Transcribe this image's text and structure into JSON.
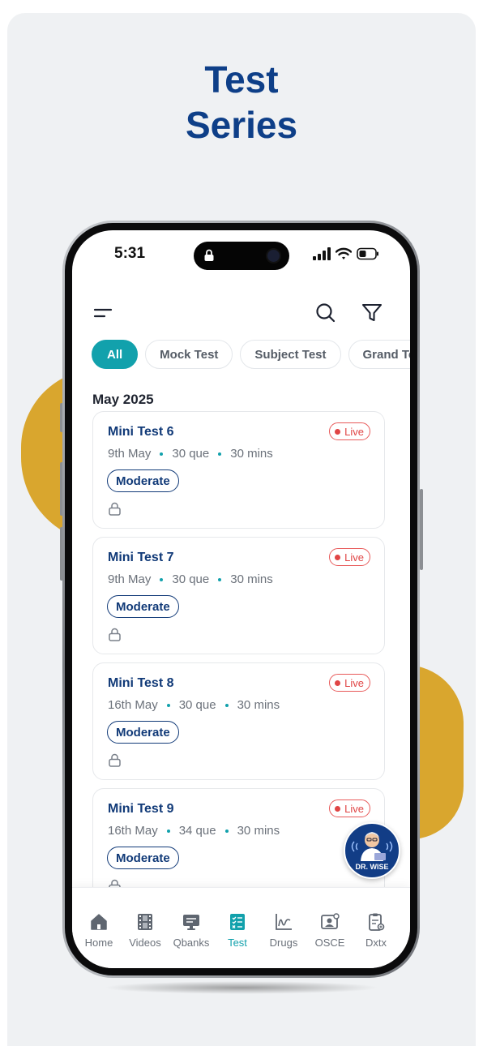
{
  "headline": {
    "line1": "Test",
    "line2": "Series"
  },
  "status_bar": {
    "time": "5:31"
  },
  "toolbar": {
    "menu_icon": "menu-icon",
    "search_icon": "search-icon",
    "filter_icon": "filter-icon"
  },
  "filters": {
    "chips": [
      {
        "label": "All",
        "active": true
      },
      {
        "label": "Mock Test",
        "active": false
      },
      {
        "label": "Subject Test",
        "active": false
      },
      {
        "label": "Grand Test",
        "active": false
      }
    ]
  },
  "section": {
    "title": "May 2025"
  },
  "tests": [
    {
      "title": "Mini Test 6",
      "status": "Live",
      "date": "9th May",
      "questions": "30 que",
      "duration": "30 mins",
      "level": "Moderate"
    },
    {
      "title": "Mini Test 7",
      "status": "Live",
      "date": "9th May",
      "questions": "30 que",
      "duration": "30 mins",
      "level": "Moderate"
    },
    {
      "title": "Mini Test 8",
      "status": "Live",
      "date": "16th May",
      "questions": "30 que",
      "duration": "30 mins",
      "level": "Moderate"
    },
    {
      "title": "Mini Test 9",
      "status": "Live",
      "date": "16th May",
      "questions": "34 que",
      "duration": "30 mins",
      "level": "Moderate"
    }
  ],
  "assistant": {
    "label": "DR. WISE"
  },
  "bottom_nav": {
    "items": [
      {
        "label": "Home",
        "icon": "home-icon"
      },
      {
        "label": "Videos",
        "icon": "film-icon"
      },
      {
        "label": "Qbanks",
        "icon": "qbank-icon"
      },
      {
        "label": "Test",
        "icon": "test-icon",
        "active": true
      },
      {
        "label": "Drugs",
        "icon": "chart-icon"
      },
      {
        "label": "OSCE",
        "icon": "osce-icon"
      },
      {
        "label": "Dxtx",
        "icon": "clipboard-icon"
      }
    ]
  },
  "colors": {
    "brand_blue": "#0e3f88",
    "accent_teal": "#12a1ac",
    "live_red": "#e04545",
    "blob_yellow": "#d9a62e",
    "panel_bg": "#eff1f3"
  }
}
